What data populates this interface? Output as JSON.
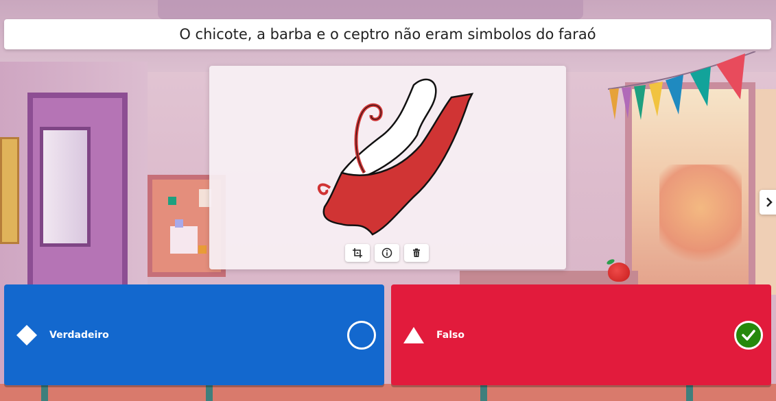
{
  "question": {
    "text": "O chicote, a barba e o ceptro não eram simbolos do faraó"
  },
  "image_card": {
    "illustration": "red-white-crown-icon",
    "tools": [
      "crop-icon",
      "info-icon",
      "trash-icon"
    ]
  },
  "navigation": {
    "next": "chevron-right-icon"
  },
  "answers": [
    {
      "label": "Verdadeiro",
      "shape": "diamond-icon",
      "color": "#1368ce",
      "state": "unselected"
    },
    {
      "label": "Falso",
      "shape": "triangle-icon",
      "color": "#e21b3c",
      "state": "correct"
    }
  ],
  "colors": {
    "correct": "#26890c",
    "crown_red": "#d03434"
  }
}
